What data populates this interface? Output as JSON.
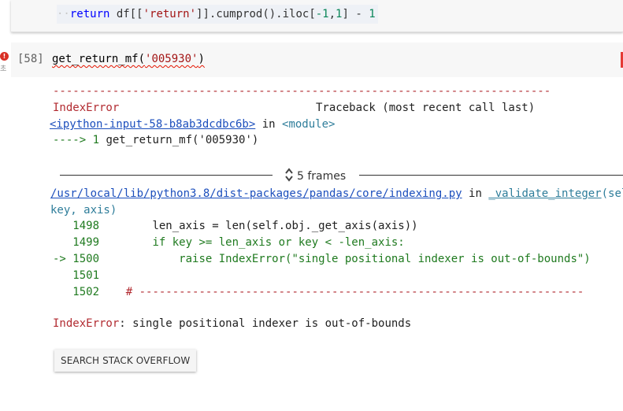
{
  "previous_cell": {
    "indent_guide": "··",
    "keyword_return": "return",
    "code_a": " df[[",
    "code_str": "'return'",
    "code_b": "]].cumprod().iloc[",
    "code_num_a": "-1",
    "code_c": ",",
    "code_num_b": "1",
    "code_d": "]",
    "code_e": " - ",
    "code_num_c": "1"
  },
  "cell": {
    "execution_count": "[58]",
    "exec_time": "초",
    "error_badge": "!",
    "code_func": "get_return_mf(",
    "code_arg": "'005930'",
    "code_close": ")"
  },
  "traceback": {
    "separator": "---------------------------------------------------------------------------",
    "error_type": "IndexError",
    "traceback_header": "Traceback (most recent call last)",
    "input_link": "<ipython-input-58-b8ab3dcdbc6b>",
    "in_word": " in ",
    "module": "<module>",
    "arrow_line_prefix": "----> 1 ",
    "arrow_line_code": "get_return_mf('005930')",
    "frames_label": "5 frames",
    "file_link": "/usr/local/lib/python3.8/dist-packages/pandas/core/indexing.py",
    "file_in": " in ",
    "func_name": "_validate_integer",
    "func_args_1": "(self,",
    "func_args_2": "key, axis)",
    "lines": [
      {
        "prefix": "   1498",
        "code": "        len_axis = len(self.obj._get_axis(axis))"
      },
      {
        "prefix": "   1499",
        "code": "        if key >= len_axis or key < -len_axis:"
      },
      {
        "prefix": "-> 1500",
        "code": "            raise IndexError(\"single positional indexer is out-of-bounds\")"
      },
      {
        "prefix": "   1501",
        "code": ""
      },
      {
        "prefix": "   1502",
        "code": "    # -------------------------------------------------------------------"
      }
    ],
    "final_error_type": "IndexError",
    "final_error_message": ": single positional indexer is out-of-bounds"
  },
  "search_button_label": "SEARCH STACK OVERFLOW"
}
